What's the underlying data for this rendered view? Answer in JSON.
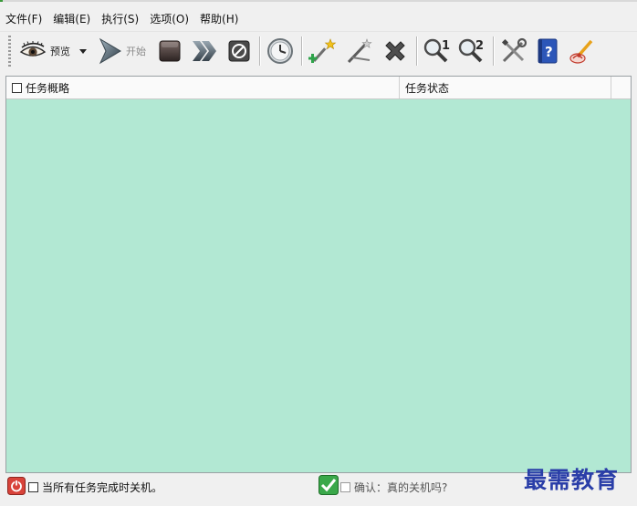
{
  "menu": [
    "文件(F)",
    "编辑(E)",
    "执行(S)",
    "选项(O)",
    "帮助(H)"
  ],
  "toolbar": {
    "preview_label": "预览",
    "start_label": "开始",
    "icons": [
      "eye-icon",
      "dropdown-arrow-icon",
      "play-icon",
      "stop-icon",
      "next-icon",
      "cancel-icon",
      "clock-icon",
      "add-task-icon",
      "wand-icon",
      "delete-icon",
      "find-1-icon",
      "find-2-icon",
      "tools-icon",
      "help-book-icon",
      "brush-icon"
    ]
  },
  "list": {
    "columns": [
      "任务概略",
      "任务状态"
    ],
    "rows": []
  },
  "status": {
    "shutdown_label": "当所有任务完成时关机。",
    "confirm_label": "确认：真的关机吗?"
  },
  "watermark": "最需教育",
  "colors": {
    "list_bg": "#b2e8d3",
    "window_bg": "#f0f0f0",
    "watermark": "#2a3ea8"
  }
}
